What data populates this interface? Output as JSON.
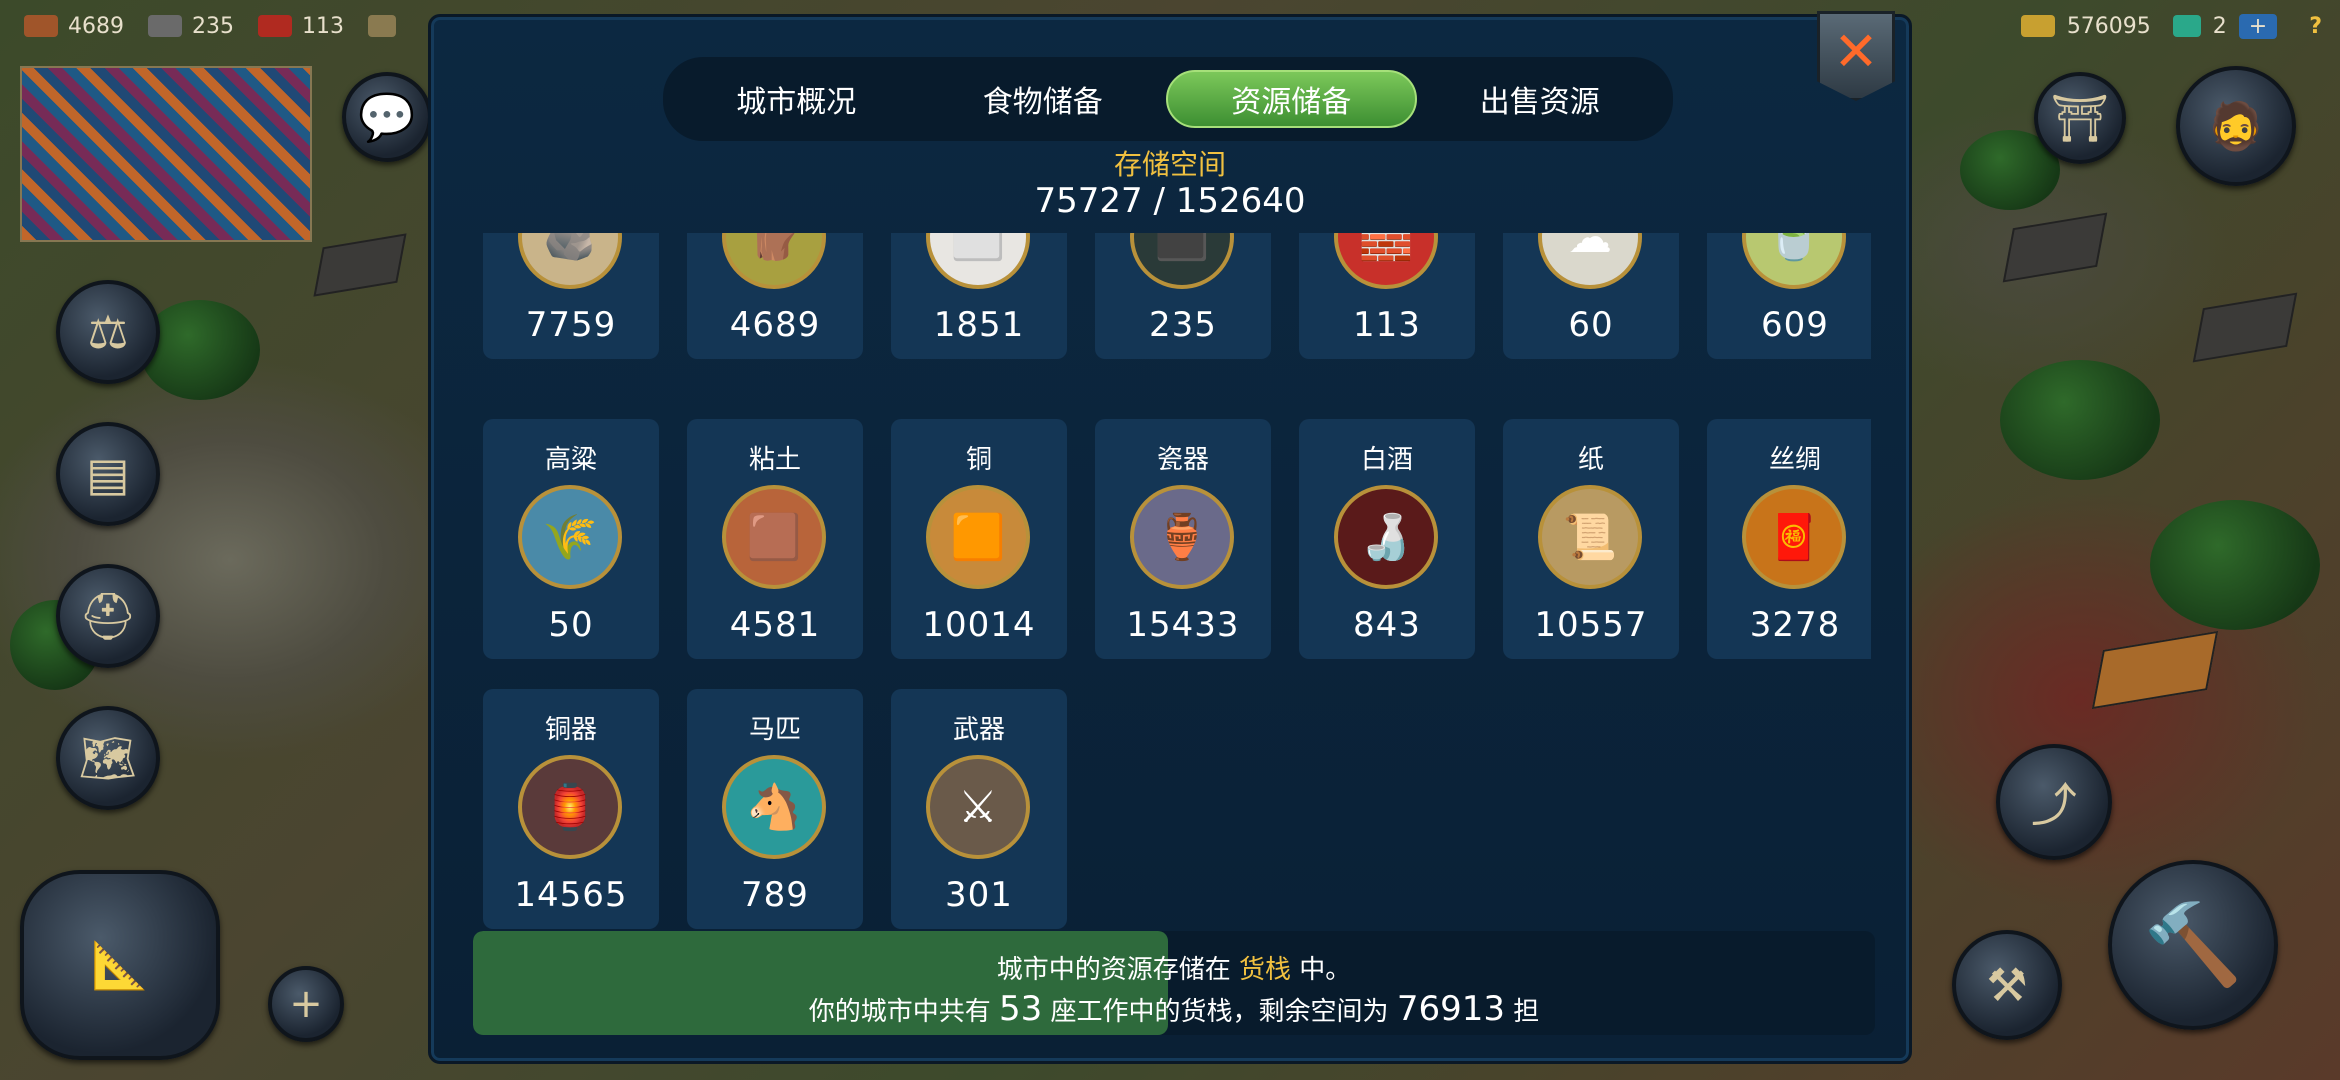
{
  "top_bar": {
    "left": [
      {
        "icon": "wood-icon",
        "value": "4689"
      },
      {
        "icon": "stone-icon",
        "value": "235"
      },
      {
        "icon": "brick-icon",
        "value": "113"
      }
    ],
    "gold": "576095",
    "gems": "2",
    "plus": "+",
    "help": "?"
  },
  "tabs": [
    {
      "label": "城市概况",
      "active": false
    },
    {
      "label": "食物储备",
      "active": false
    },
    {
      "label": "资源储备",
      "active": true
    },
    {
      "label": "出售资源",
      "active": false
    }
  ],
  "storage": {
    "title": "存储空间",
    "value": "75727 / 152640"
  },
  "resources_row1": [
    {
      "icon": "ore-icon",
      "amount": "7759"
    },
    {
      "icon": "wood-logs-icon",
      "amount": "4689"
    },
    {
      "icon": "marble-icon",
      "amount": "1851"
    },
    {
      "icon": "coal-icon",
      "amount": "235"
    },
    {
      "icon": "brick-icon",
      "amount": "113"
    },
    {
      "icon": "cotton-icon",
      "amount": "60"
    },
    {
      "icon": "tea-icon",
      "amount": "609"
    }
  ],
  "resources_row2": [
    {
      "name": "高粱",
      "icon": "sorghum-icon",
      "amount": "50"
    },
    {
      "name": "粘土",
      "icon": "clay-icon",
      "amount": "4581"
    },
    {
      "name": "铜",
      "icon": "copper-icon",
      "amount": "10014"
    },
    {
      "name": "瓷器",
      "icon": "porcelain-icon",
      "amount": "15433"
    },
    {
      "name": "白酒",
      "icon": "liquor-icon",
      "amount": "843"
    },
    {
      "name": "纸",
      "icon": "paper-icon",
      "amount": "10557"
    },
    {
      "name": "丝绸",
      "icon": "silk-icon",
      "amount": "3278"
    }
  ],
  "resources_row3": [
    {
      "name": "铜器",
      "icon": "bronzeware-icon",
      "amount": "14565"
    },
    {
      "name": "马匹",
      "icon": "horse-icon",
      "amount": "789"
    },
    {
      "name": "武器",
      "icon": "weapons-icon",
      "amount": "301"
    }
  ],
  "info": {
    "line1_pre": "城市中的资源存储在",
    "line1_highlight": "货栈",
    "line1_post": "中。",
    "line2_pre": "你的城市中共有",
    "line2_count": "53",
    "line2_mid": "座工作中的货栈，剩余空间为",
    "line2_space": "76913",
    "line2_unit": "担",
    "fill_fraction": 0.496
  },
  "colors": {
    "active_tab": "#5aae44",
    "highlight": "#f0c040",
    "card_bg": "#143655",
    "modal_bg": "#0c2841"
  }
}
